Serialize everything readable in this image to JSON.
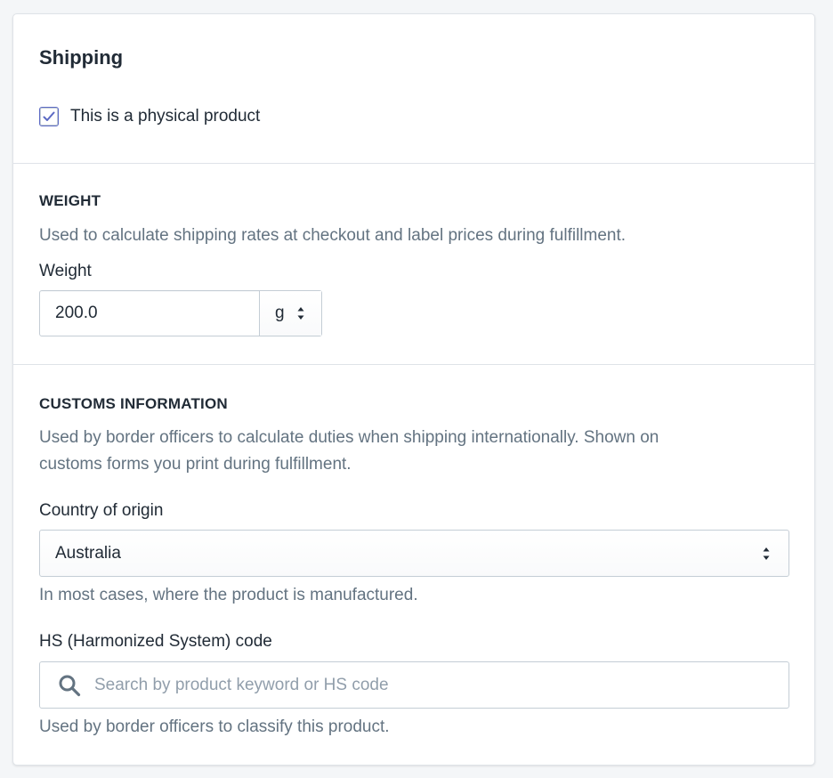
{
  "card": {
    "title": "Shipping",
    "physical_checkbox": {
      "label": "This is a physical product",
      "checked": true
    }
  },
  "weight": {
    "heading": "WEIGHT",
    "help": "Used to calculate shipping rates at checkout and label prices during fulfillment.",
    "label": "Weight",
    "value": "200.0",
    "unit": "g"
  },
  "customs": {
    "heading": "CUSTOMS INFORMATION",
    "help_line1": "Used by border officers to calculate duties when shipping internationally. Shown on",
    "help_line2": "customs forms you print during fulfillment.",
    "country_label": "Country of origin",
    "country_value": "Australia",
    "country_help": "In most cases, where the product is manufactured.",
    "hs_label": "HS (Harmonized System) code",
    "hs_placeholder": "Search by product keyword or HS code",
    "hs_help": "Used by border officers to classify this product."
  },
  "colors": {
    "accent": "#5c6ac4",
    "text": "#212b36",
    "subdued": "#637381",
    "border": "#c4cdd5",
    "page_bg": "#f4f6f8"
  },
  "icons": {
    "checkbox": "check-icon",
    "select": "select-arrows-icon",
    "search": "search-icon"
  }
}
